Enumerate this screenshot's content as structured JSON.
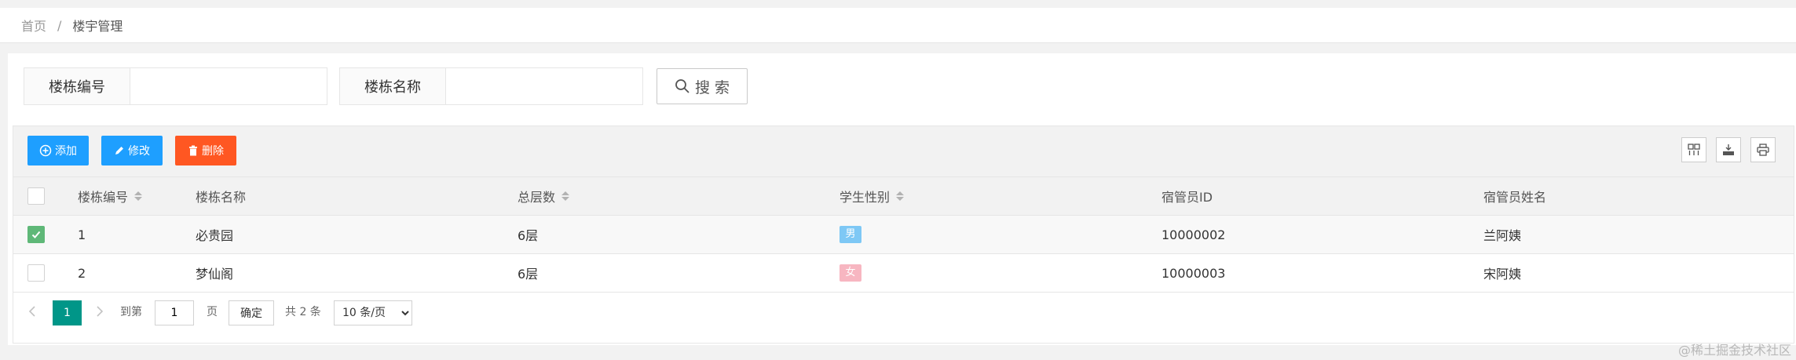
{
  "breadcrumb": {
    "home": "首页",
    "separator": "/",
    "current": "楼宇管理"
  },
  "search": {
    "field1_label": "楼栋编号",
    "field1_value": "",
    "field2_label": "楼栋名称",
    "field2_value": "",
    "button_label": "搜 索"
  },
  "toolbar": {
    "add_label": "添加",
    "edit_label": "修改",
    "delete_label": "删除",
    "right_icons": [
      "columns-icon",
      "export-icon",
      "print-icon"
    ]
  },
  "table": {
    "headers": [
      "楼栋编号",
      "楼栋名称",
      "总层数",
      "学生性别",
      "宿管员ID",
      "宿管员姓名"
    ],
    "rows": [
      {
        "selected": true,
        "id": "1",
        "name": "必贵园",
        "floors": "6层",
        "gender": "男",
        "manager_id": "10000002",
        "manager_name": "兰阿姨"
      },
      {
        "selected": false,
        "id": "2",
        "name": "梦仙阁",
        "floors": "6层",
        "gender": "女",
        "manager_id": "10000003",
        "manager_name": "宋阿姨"
      }
    ]
  },
  "pagination": {
    "current_page": "1",
    "goto_label": "到第",
    "goto_value": "1",
    "page_unit": "页",
    "confirm_label": "确定",
    "total_text": "共 2 条",
    "page_size": "10 条/页"
  },
  "colors": {
    "primary": "#1e9fff",
    "danger": "#ff5722",
    "accent": "#009688",
    "check": "#5fb878",
    "male_badge": "#7ec8f5",
    "female_badge": "#f7b6c1"
  },
  "watermark": "@稀土掘金技术社区"
}
